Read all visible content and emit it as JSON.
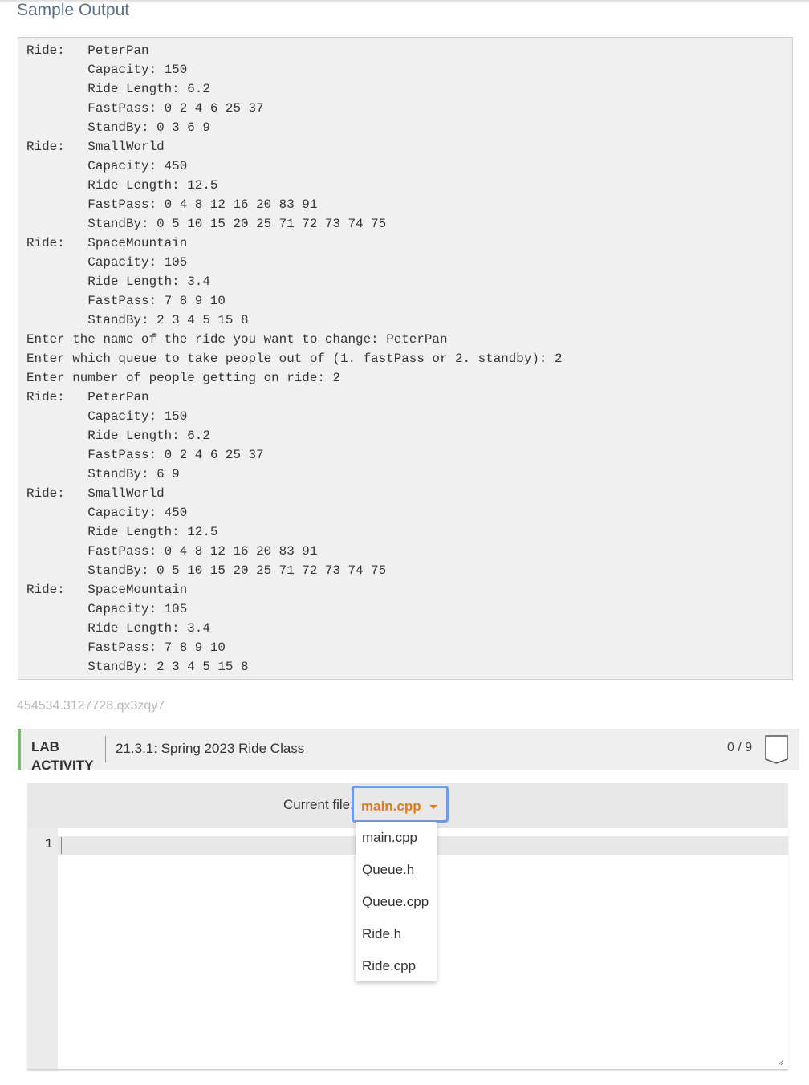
{
  "section": {
    "title": "Sample Output"
  },
  "sample_output": {
    "lines": [
      "Ride:   PeterPan",
      "        Capacity: 150",
      "        Ride Length: 6.2",
      "        FastPass: 0 2 4 6 25 37",
      "        StandBy: 0 3 6 9",
      "Ride:   SmallWorld",
      "        Capacity: 450",
      "        Ride Length: 12.5",
      "        FastPass: 0 4 8 12 16 20 83 91",
      "        StandBy: 0 5 10 15 20 25 71 72 73 74 75",
      "Ride:   SpaceMountain",
      "        Capacity: 105",
      "        Ride Length: 3.4",
      "        FastPass: 7 8 9 10",
      "        StandBy: 2 3 4 5 15 8",
      "Enter the name of the ride you want to change: PeterPan",
      "Enter which queue to take people out of (1. fastPass or 2. standby): 2",
      "Enter number of people getting on ride: 2",
      "Ride:   PeterPan",
      "        Capacity: 150",
      "        Ride Length: 6.2",
      "        FastPass: 0 2 4 6 25 37",
      "        StandBy: 6 9",
      "Ride:   SmallWorld",
      "        Capacity: 450",
      "        Ride Length: 12.5",
      "        FastPass: 0 4 8 12 16 20 83 91",
      "        StandBy: 0 5 10 15 20 25 71 72 73 74 75",
      "Ride:   SpaceMountain",
      "        Capacity: 105",
      "        Ride Length: 3.4",
      "        FastPass: 7 8 9 10",
      "        StandBy: 2 3 4 5 15 8"
    ]
  },
  "identifier": "454534.3127728.qx3zqy7",
  "lab": {
    "type_line1": "LAB",
    "type_line2": "ACTIVITY",
    "title": "21.3.1: Spring 2023 Ride Class",
    "score": "0 / 9",
    "accent_color": "#78b871"
  },
  "file_selector": {
    "label": "Current file:",
    "current": "main.cpp",
    "accent_color": "#e27b16",
    "focus_color": "#6f9af0",
    "options": [
      "main.cpp",
      "Queue.h",
      "Queue.cpp",
      "Ride.h",
      "Ride.cpp"
    ]
  },
  "editor": {
    "line_number": "1"
  }
}
